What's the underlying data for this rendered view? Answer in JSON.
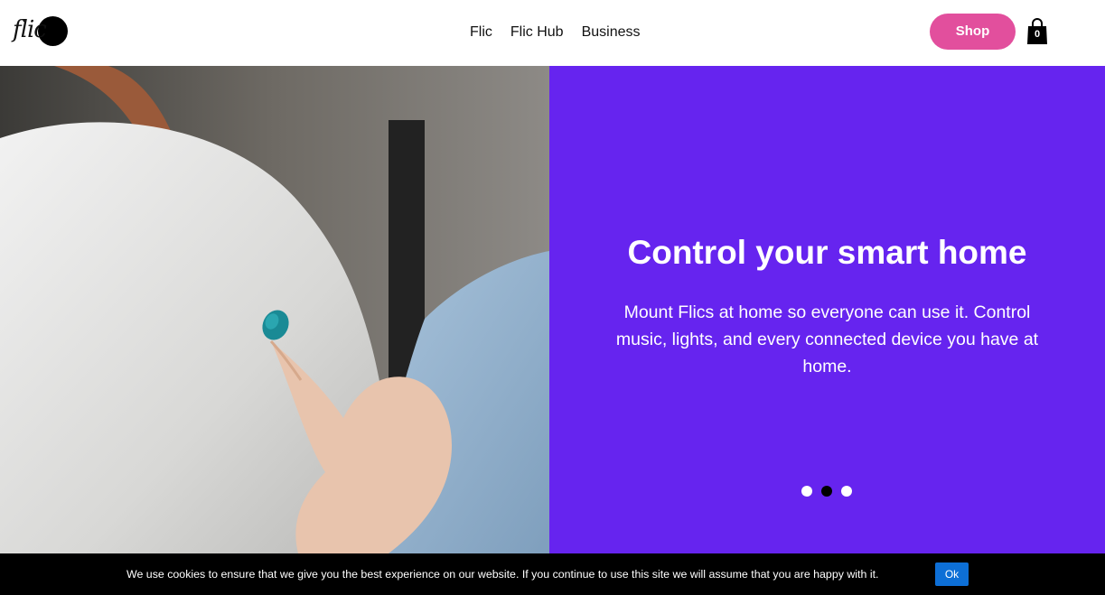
{
  "header": {
    "logo_text": "flic",
    "nav": [
      {
        "label": "Flic"
      },
      {
        "label": "Flic Hub"
      },
      {
        "label": "Business"
      }
    ],
    "shop_label": "Shop",
    "cart_count": "0"
  },
  "hero": {
    "title": "Control your smart home",
    "description": "Mount Flics at home so everyone can use it. Control music, lights, and every connected device you have at home.",
    "slide_count": 3,
    "active_slide": 2
  },
  "cookie": {
    "message": "We use cookies to ensure that we give you the best experience on our website. If you continue to use this site we will assume that you are happy with it.",
    "ok_label": "Ok"
  },
  "colors": {
    "panel": "#6624ef",
    "shop_button": "#e24f9d",
    "cookie_bar": "#000000",
    "ok_button": "#0d6fd6",
    "button_teal": "#1a8a95"
  }
}
